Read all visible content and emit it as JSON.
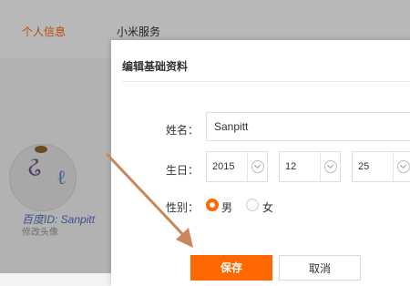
{
  "tabs": [
    {
      "label": "个人信息",
      "active": true
    },
    {
      "label": "小米服务",
      "active": false
    }
  ],
  "watermark": {
    "text": "百度ID: Sanpitt",
    "subtext": "修改头像"
  },
  "modal": {
    "title": "编辑基础资料",
    "name_label": "姓名：",
    "name_value": "Sanpitt",
    "birth_label": "生日：",
    "birth_year": "2015",
    "birth_month": "12",
    "birth_day": "25",
    "gender_label": "性别：",
    "gender_male": "男",
    "gender_female": "女",
    "selected_gender": "男",
    "save_label": "保存",
    "cancel_label": "取消"
  },
  "colors": {
    "accent": "#ff6700",
    "annotation_arrow": "#c8875a"
  },
  "icons": [
    "chevron-down-icon",
    "radio-icon",
    "annotation-arrow-icon"
  ]
}
